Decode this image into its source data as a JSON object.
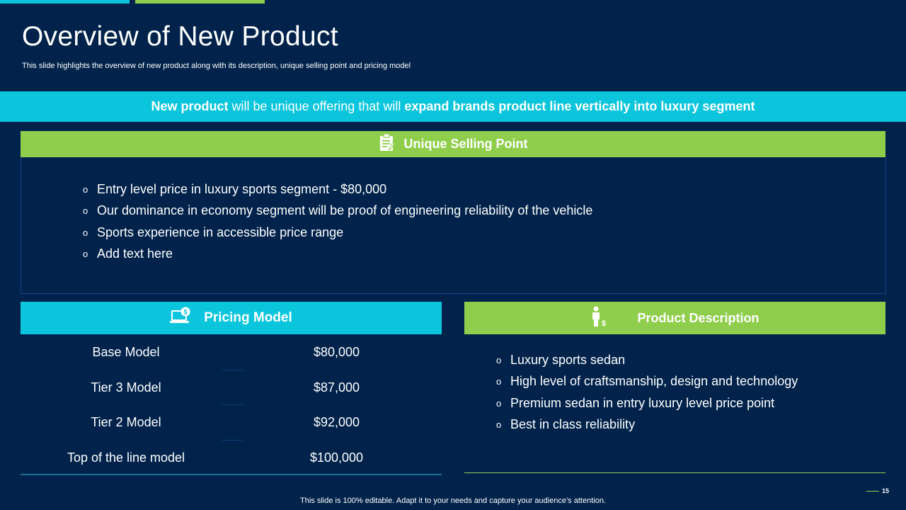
{
  "slide": {
    "title": "Overview of New Product",
    "subtitle": "This slide highlights the overview of new product along with its description, unique selling point and pricing model",
    "page_number": "15",
    "footer": "This slide is 100% editable. Adapt it to your needs and capture your audience's attention."
  },
  "banner": {
    "bold_1": "New product",
    "text_2": " will be unique offering that will ",
    "bold_3": "expand brands product line vertically into luxury segment"
  },
  "usp": {
    "heading": "Unique Selling Point",
    "icon": "clipboard-icon",
    "items": [
      "Entry level price in luxury sports segment - $80,000",
      "Our dominance in economy segment will be proof of engineering reliability of the vehicle",
      "Sports experience in accessible price range",
      "Add text here"
    ]
  },
  "pricing": {
    "heading": "Pricing Model",
    "icon": "laptop-dollar-icon",
    "rows": [
      {
        "model": "Base Model",
        "price": "$80,000"
      },
      {
        "model": "Tier 3 Model",
        "price": "$87,000"
      },
      {
        "model": "Tier 2 Model",
        "price": "$92,000"
      },
      {
        "model": "Top of the line model",
        "price": "$100,000"
      }
    ]
  },
  "description": {
    "heading": "Product Description",
    "icon": "person-dollar-icon",
    "items": [
      "Luxury sports sedan",
      "High level of craftsmanship, design and technology",
      "Premium sedan in entry luxury level price point",
      "Best in class reliability"
    ]
  },
  "colors": {
    "background": "#01234b",
    "cyan": "#0bc5dc",
    "green": "#8fce4c"
  }
}
